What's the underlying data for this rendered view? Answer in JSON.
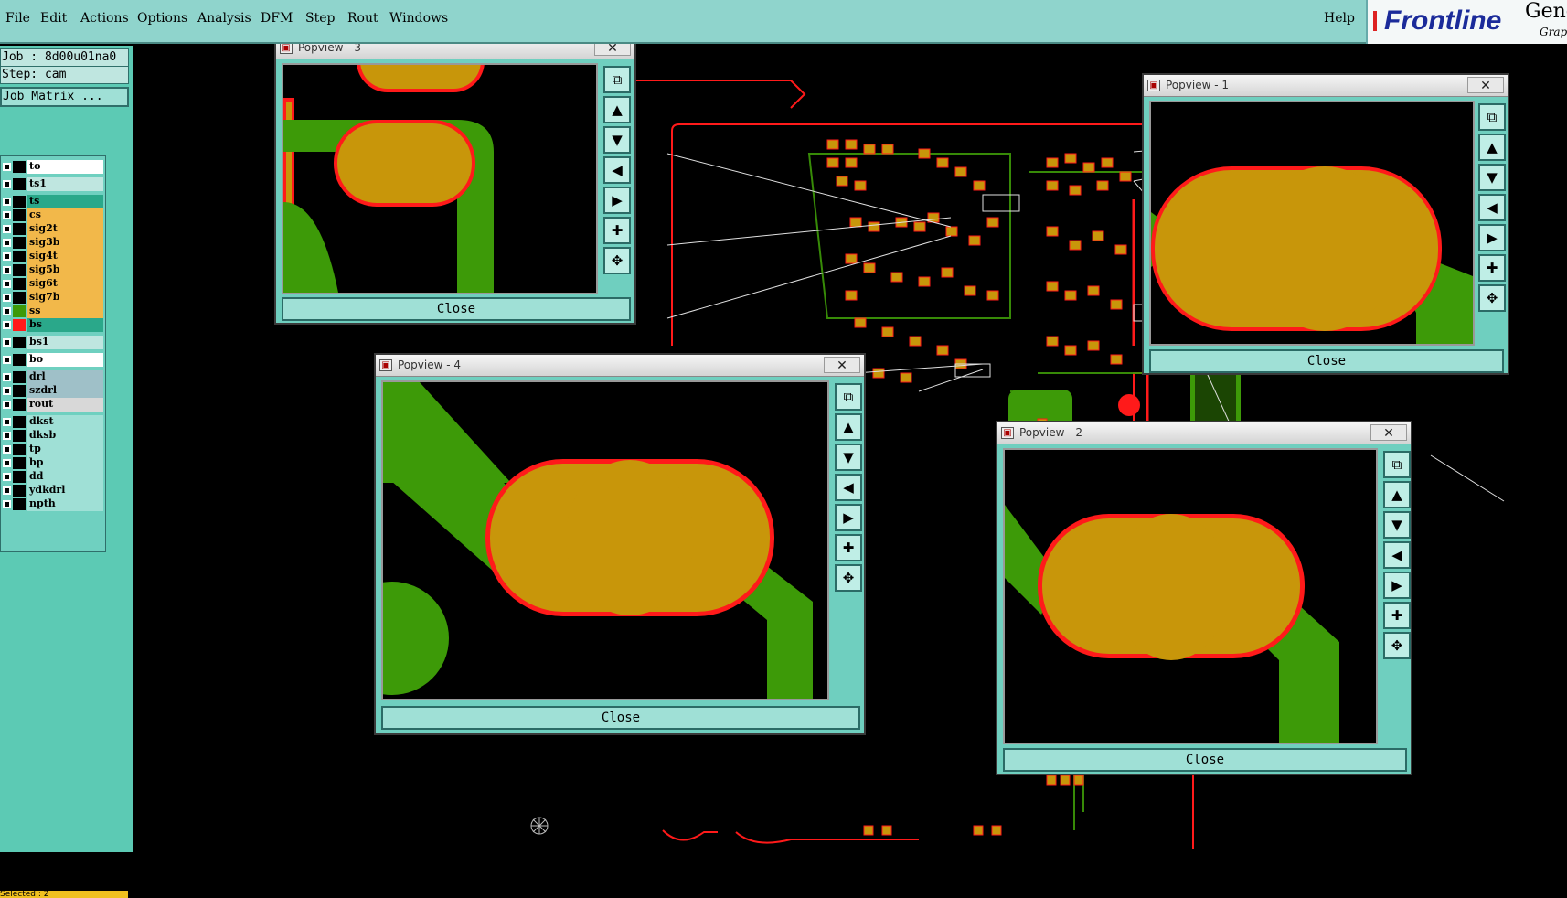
{
  "menu": {
    "file": "File",
    "edit": "Edit",
    "actions": "Actions",
    "options": "Options",
    "analysis": "Analysis",
    "dfm": "DFM",
    "step": "Step",
    "rout": "Rout",
    "windows": "Windows",
    "help": "Help"
  },
  "logo": {
    "brand": "Frontline",
    "product": "Gene",
    "sub": "Grap"
  },
  "panel": {
    "job": "Job : 8d00u01na0",
    "step": "Step: cam",
    "matrix": "Job Matrix ...",
    "selected": "Selected : 2"
  },
  "layers": [
    {
      "name": "to",
      "color": "#ffffff"
    },
    {
      "name": "ts1",
      "color": "#bfe6e0"
    },
    {
      "name": "ts",
      "color": "#2aa88a"
    },
    {
      "name": "cs",
      "color": "#f2b84a"
    },
    {
      "name": "sig2t",
      "color": "#f2b84a"
    },
    {
      "name": "sig3b",
      "color": "#f2b84a"
    },
    {
      "name": "sig4t",
      "color": "#f2b84a"
    },
    {
      "name": "sig5b",
      "color": "#f2b84a"
    },
    {
      "name": "sig6t",
      "color": "#f2b84a"
    },
    {
      "name": "sig7b",
      "color": "#f2b84a"
    },
    {
      "name": "ss",
      "color": "#f2b84a"
    },
    {
      "name": "bs",
      "color": "#2aa88a"
    },
    {
      "name": "bs1",
      "color": "#bfe6e0"
    },
    {
      "name": "bo",
      "color": "#ffffff"
    },
    {
      "name": "drl",
      "color": "#9fc0c8"
    },
    {
      "name": "szdrl",
      "color": "#9fc0c8"
    },
    {
      "name": "rout",
      "color": "#d8d8d8"
    },
    {
      "name": "dkst",
      "color": "#9fe0d6"
    },
    {
      "name": "dksb",
      "color": "#9fe0d6"
    },
    {
      "name": "tp",
      "color": "#9fe0d6"
    },
    {
      "name": "bp",
      "color": "#9fe0d6"
    },
    {
      "name": "dd",
      "color": "#9fe0d6"
    },
    {
      "name": "ydkdrl",
      "color": "#9fe0d6"
    },
    {
      "name": "npth",
      "color": "#9fe0d6"
    }
  ],
  "popviews": [
    {
      "title": "Popview - 3",
      "close": "Close"
    },
    {
      "title": "Popview - 1",
      "close": "Close"
    },
    {
      "title": "Popview - 4",
      "close": "Close"
    },
    {
      "title": "Popview - 2",
      "close": "Close"
    }
  ],
  "colors": {
    "pad": "#c8960a",
    "trace": "#3d9a08",
    "outline": "#ff1a1a",
    "panel": "#5ccab4",
    "menubar": "#8fd4cc"
  },
  "icons": [
    "zoom-fit-icon",
    "pan-up-icon",
    "pan-down-icon",
    "pan-left-icon",
    "pan-right-icon",
    "zoom-in-icon",
    "zoom-out-icon"
  ]
}
